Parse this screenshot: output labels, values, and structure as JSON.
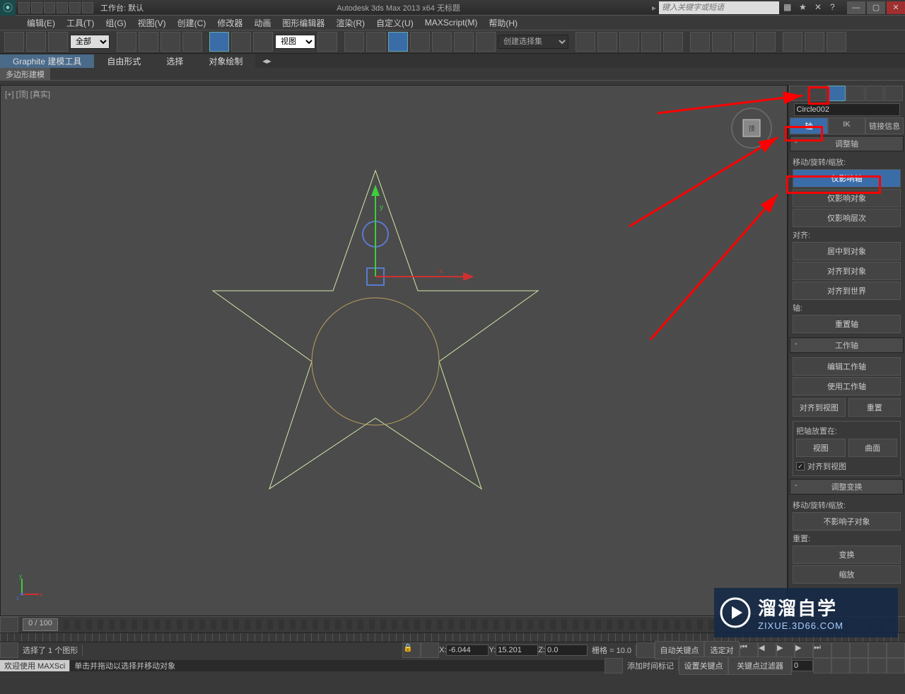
{
  "title": "Autodesk 3ds Max  2013 x64     无标题",
  "workspace_label": "工作台: 默认",
  "search_placeholder": "键入关键字或短语",
  "menubar": [
    "编辑(E)",
    "工具(T)",
    "组(G)",
    "视图(V)",
    "创建(C)",
    "修改器",
    "动画",
    "图形编辑器",
    "渲染(R)",
    "自定义(U)",
    "MAXScript(M)",
    "帮助(H)"
  ],
  "toolbar": {
    "filter_sel": "全部",
    "view_sel": "视图",
    "named_set_placeholder": "创建选择集"
  },
  "ribbon": {
    "tabs": [
      "Graphite 建模工具",
      "自由形式",
      "选择",
      "对象绘制"
    ],
    "polylabel": "多边形建模"
  },
  "viewport_label": "[+] [顶] [真实]",
  "cmd": {
    "object_name": "Circle002",
    "pivot_tabs": [
      "轴",
      "IK",
      "链接信息"
    ],
    "rollout_adjust_pivot": "调整轴",
    "move_rotate_scale": "移动/旋转/缩放:",
    "affect_pivot_only": "仅影响轴",
    "affect_object_only": "仅影响对象",
    "affect_hierarchy_only": "仅影响层次",
    "align_label": "对齐:",
    "center_to_obj": "居中到对象",
    "align_to_obj": "对齐到对象",
    "align_to_world": "对齐到世界",
    "pivot_label": "轴:",
    "reset_pivot": "重置轴",
    "rollout_working_pivot": "工作轴",
    "edit_working_pivot": "编辑工作轴",
    "use_working_pivot": "使用工作轴",
    "align_to_view_btn": "对齐到视图",
    "reset_btn": "重置",
    "place_pivot_to": "把轴放置在:",
    "view_btn": "视图",
    "surface_btn": "曲面",
    "align_to_view_chk": "对齐到视图",
    "rollout_adjust_transform": "调整变换",
    "move_rotate_scale2": "移动/旋转/缩放:",
    "dont_affect_children": "不影响子对象",
    "reset_label2": "重置:",
    "transform_btn": "变换",
    "scale_btn": "缩放"
  },
  "timeline": {
    "slider": "0 / 100"
  },
  "status": {
    "selected": "选择了 1 个图形",
    "x_lbl": "X:",
    "x_val": "-6.044",
    "y_lbl": "Y:",
    "y_val": "15.201",
    "z_lbl": "Z:",
    "z_val": "0.0",
    "grid": "栅格 = 10.0",
    "autokey": "自动关键点",
    "selected_key": "选定对",
    "setkey": "设置关键点",
    "keyfilter": "关键点过滤器",
    "welcome": "欢迎使用  MAXSci",
    "prompt": "单击并拖动以选择并移动对象",
    "add_time_tag": "添加时间标记"
  },
  "watermark": {
    "main": "溜溜自学",
    "sub": "ZIXUE.3D66.COM"
  }
}
